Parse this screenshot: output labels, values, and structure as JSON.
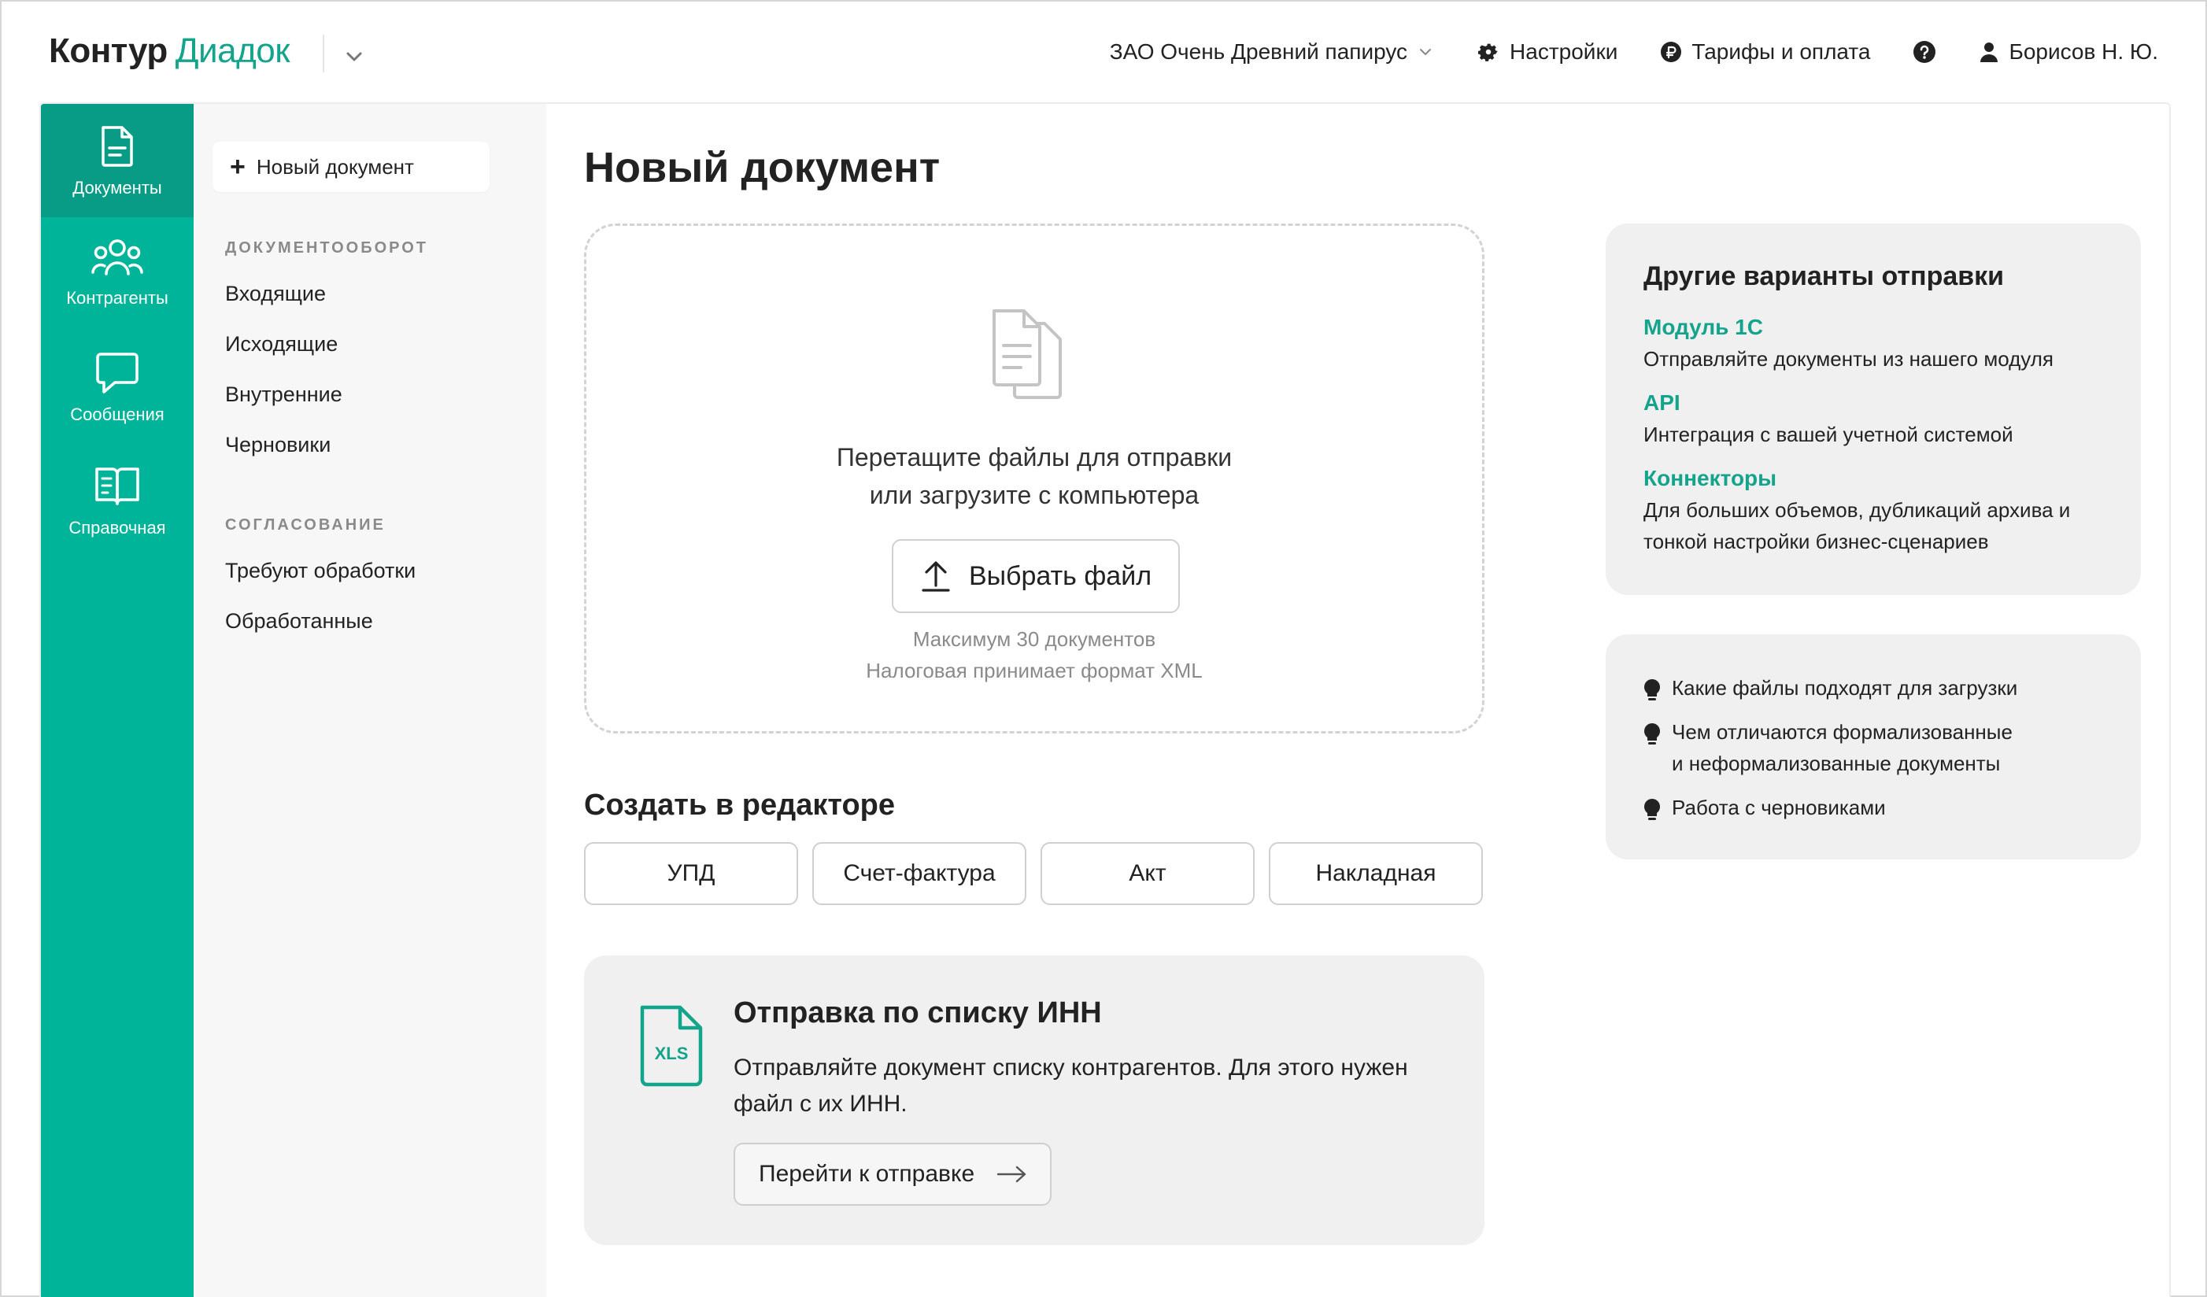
{
  "colors": {
    "accent": "#14a38b",
    "rail": "#00b499",
    "rail_active": "#089c86"
  },
  "header": {
    "logo_left": "Контур",
    "logo_right": "Диадок",
    "organization": "ЗАО Очень Древний папирус",
    "settings": "Настройки",
    "billing": "Тарифы и оплата",
    "user": "Борисов Н. Ю."
  },
  "rail": {
    "items": [
      {
        "label": "Документы",
        "icon": "document-icon",
        "active": true
      },
      {
        "label": "Контрагенты",
        "icon": "people-icon",
        "active": false
      },
      {
        "label": "Сообщения",
        "icon": "chat-icon",
        "active": false
      },
      {
        "label": "Справочная",
        "icon": "book-icon",
        "active": false
      }
    ]
  },
  "subnav": {
    "new_document": "Новый документ",
    "section_docflow": "ДОКУМЕНТООБОРОТ",
    "docflow_links": [
      "Входящие",
      "Исходящие",
      "Внутренние",
      "Черновики"
    ],
    "section_approval": "СОГЛАСОВАНИЕ",
    "approval_links": [
      "Требуют обработки",
      "Обработанные"
    ]
  },
  "main": {
    "title": "Новый документ",
    "dropzone": {
      "line1": "Перетащите файлы для отправки",
      "line2": "или загрузите с компьютера",
      "button": "Выбрать файл",
      "note1": "Максимум 30 документов",
      "note2": "Налоговая принимает формат XML"
    },
    "editor_title": "Создать в редакторе",
    "editor_buttons": [
      "УПД",
      "Счет-фактура",
      "Акт",
      "Накладная"
    ],
    "inn": {
      "icon_label": "XLS",
      "title": "Отправка по списку ИНН",
      "desc": "Отправляйте документ списку контрагентов. Для этого нужен файл с их ИНН.",
      "button": "Перейти к отправке"
    }
  },
  "side": {
    "options_title": "Другие варианты отправки",
    "options": [
      {
        "name": "Модуль 1С",
        "desc": "Отправляйте документы из нашего модуля"
      },
      {
        "name": "API",
        "desc": "Интеграция с вашей учетной системой"
      },
      {
        "name": "Коннекторы",
        "desc": "Для больших объемов, дубликаций архива и тонкой настройки бизнес-сценариев"
      }
    ],
    "tips": [
      {
        "line1": "Какие файлы подходят для загрузки"
      },
      {
        "line1": "Чем отличаются формализованные",
        "line2": "и неформализованные документы"
      },
      {
        "line1": "Работа с черновиками"
      }
    ]
  }
}
